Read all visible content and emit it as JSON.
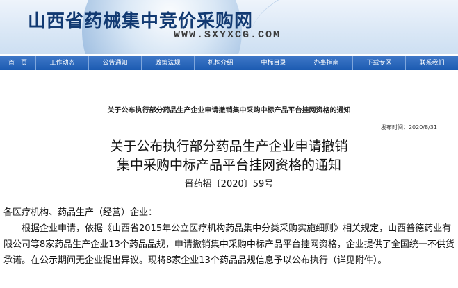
{
  "site": {
    "title": "山西省药械集中竞价采购网",
    "url": "WWW.SXYXCG.COM"
  },
  "nav": {
    "items": [
      "首　页",
      "工作动态",
      "公告通知",
      "政策法规",
      "机构介绍",
      "中标目录",
      "办事指南",
      "下载专区",
      "联系我们"
    ]
  },
  "article": {
    "breadcrumb_title": "关于公布执行部分药品生产企业申请撤销集中采购中标产品平台挂网资格的通知",
    "date": "发布时间：2020/8/31",
    "title_line1": "关于公布执行部分药品生产企业申请撤销",
    "title_line2": "集中采购中标产品平台挂网资格的通知",
    "doc_number": "晋药招〔2020〕59号",
    "salutation": "各医疗机构、药品生产（经营）企业：",
    "paragraph": "根据企业申请，依据《山西省2015年公立医疗机构药品集中分类采购实施细则》相关规定，山西普德药业有限公司等8家药品生产企业13个药品品规，申请撤销集中采购中标产品平台挂网资格，企业提供了全国统一不供货承诺。在公示期间无企业提出异议。现将8家企业13个药品品规信息予以公布执行（详见附件）。"
  }
}
